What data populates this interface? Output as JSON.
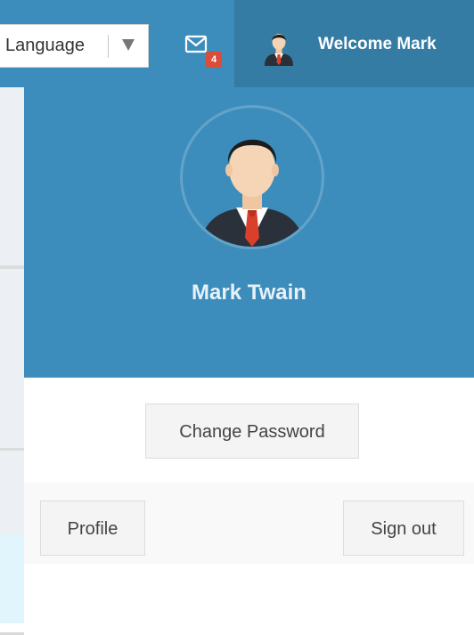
{
  "navbar": {
    "language_label": "Language",
    "mail_icon": "envelope-icon",
    "mail_badge": "4",
    "welcome_text": "Welcome Mark"
  },
  "user_menu": {
    "name": "Mark Twain",
    "change_password_label": "Change Password",
    "profile_label": "Profile",
    "signout_label": "Sign out"
  },
  "colors": {
    "navbar_primary": "#3c8dbc",
    "navbar_dark": "#357ca5",
    "badge": "#dd4b39"
  }
}
